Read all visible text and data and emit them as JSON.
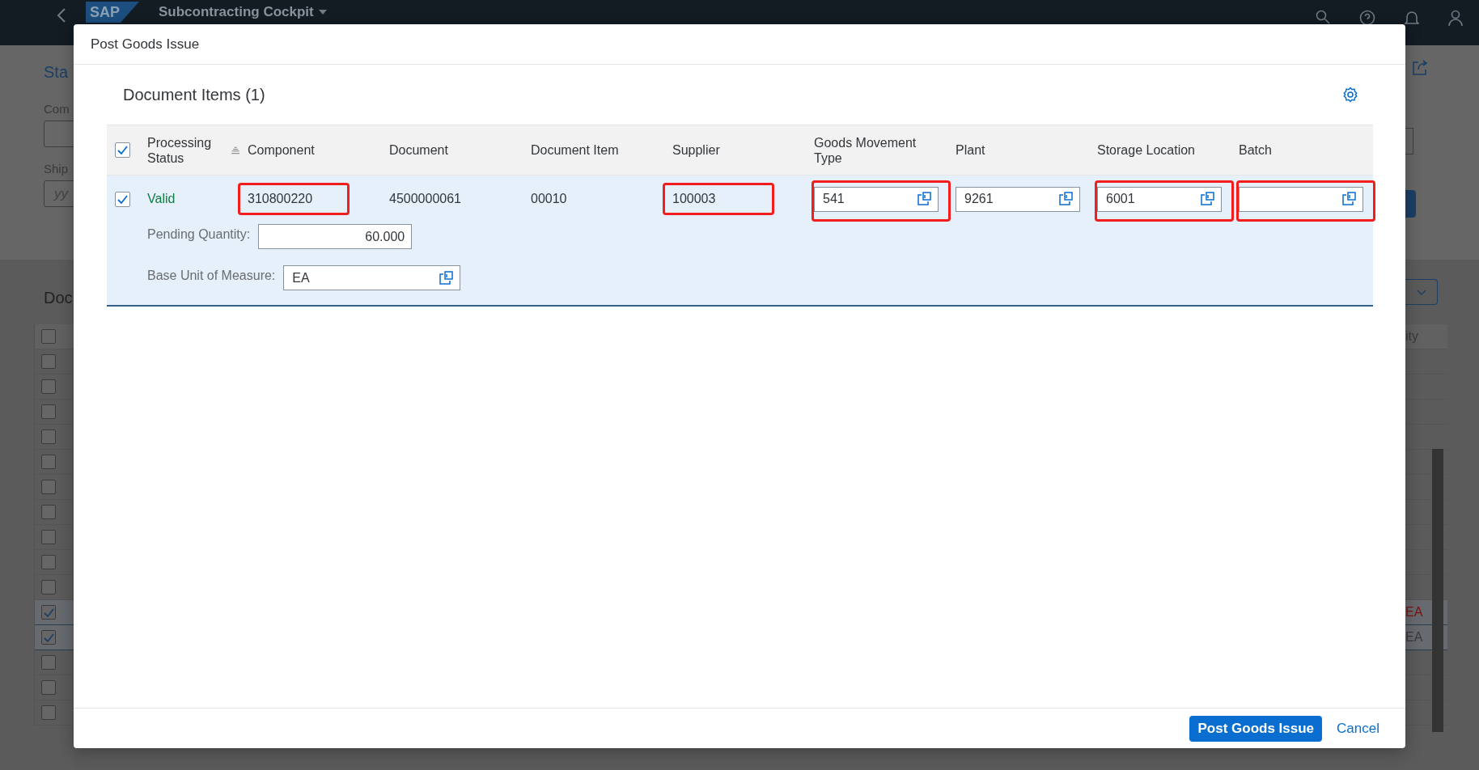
{
  "shell": {
    "logo": "SAP",
    "title": "Subcontracting Cockpit"
  },
  "background": {
    "header_checked": false,
    "title": "Sta",
    "labels": [
      "Com",
      "Ship"
    ],
    "placeholder": "yy",
    "section": "Doc",
    "column": "ity",
    "rows": [
      {
        "selected": false
      },
      {
        "selected": false
      },
      {
        "selected": false
      },
      {
        "selected": false
      },
      {
        "selected": false
      },
      {
        "selected": false
      },
      {
        "selected": false
      },
      {
        "selected": false
      },
      {
        "selected": false
      },
      {
        "selected": false
      },
      {
        "selected": true,
        "unit": {
          "text": "EA",
          "kind": "error"
        }
      },
      {
        "selected": true,
        "unit": {
          "text": "EA",
          "kind": "normal"
        }
      },
      {
        "selected": false
      },
      {
        "selected": false
      },
      {
        "selected": false
      }
    ]
  },
  "dialog": {
    "title": "Post Goods Issue",
    "section_title": "Document Items (1)",
    "table": {
      "select_all": {
        "checked": true
      },
      "columns": [
        {
          "label": "Processing Status",
          "sortable": true
        },
        {
          "label": "Component"
        },
        {
          "label": "Document"
        },
        {
          "label": "Document Item"
        },
        {
          "label": "Supplier"
        },
        {
          "label": "Goods Movement Type"
        },
        {
          "label": "Plant"
        },
        {
          "label": "Storage Location"
        },
        {
          "label": "Batch"
        }
      ],
      "rows": [
        {
          "selected": true,
          "cells": [
            {
              "kind": "status",
              "value": "Valid",
              "status": {
                "kind": "success"
              }
            },
            {
              "kind": "text",
              "value": "310800220",
              "highlighted": true
            },
            {
              "kind": "text",
              "value": "4500000061",
              "highlighted": false
            },
            {
              "kind": "text",
              "value": "00010",
              "highlighted": false
            },
            {
              "kind": "text",
              "value": "100003",
              "highlighted": true
            },
            {
              "kind": "input",
              "value": "541",
              "highlighted": true
            },
            {
              "kind": "input",
              "value": "9261",
              "highlighted": false
            },
            {
              "kind": "input",
              "value": "6001",
              "highlighted": true
            },
            {
              "kind": "input",
              "highlighted": true
            }
          ],
          "details": [
            {
              "label": "Pending Quantity:",
              "value": "60.000",
              "value_help": false
            },
            {
              "label": "Base Unit of Measure:",
              "value": "EA",
              "value_help": true
            }
          ]
        }
      ]
    },
    "buttons": [
      {
        "label": "Post Goods Issue",
        "kind": "emphasized"
      },
      {
        "label": "Cancel",
        "kind": "transparent"
      }
    ]
  }
}
